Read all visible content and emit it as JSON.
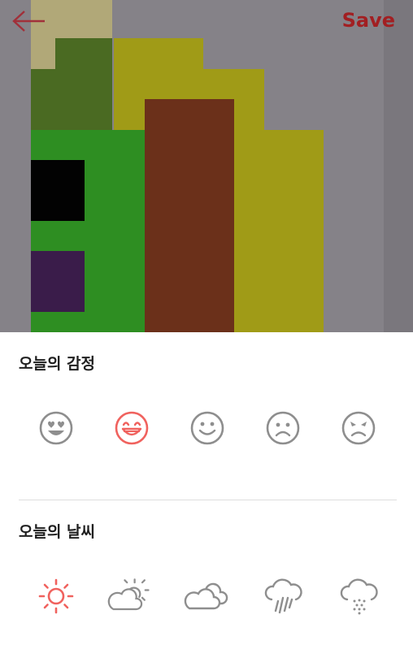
{
  "toolbar": {
    "save_label": "Save"
  },
  "emotion": {
    "title": "오늘의 감정",
    "options": [
      {
        "name": "love-face-icon",
        "selected": false
      },
      {
        "name": "grin-face-icon",
        "selected": true
      },
      {
        "name": "smile-face-icon",
        "selected": false
      },
      {
        "name": "sad-face-icon",
        "selected": false
      },
      {
        "name": "angry-face-icon",
        "selected": false
      }
    ]
  },
  "weather": {
    "title": "오늘의 날씨",
    "options": [
      {
        "name": "sun-icon",
        "selected": true
      },
      {
        "name": "partly-cloudy-icon",
        "selected": false
      },
      {
        "name": "cloudy-icon",
        "selected": false
      },
      {
        "name": "rain-icon",
        "selected": false
      },
      {
        "name": "snow-icon",
        "selected": false
      }
    ]
  },
  "colors": {
    "accent": "#f0625e",
    "icon_gray": "#8e8e8e",
    "save_red": "#a21f22",
    "back_arrow": "#a1303a"
  }
}
